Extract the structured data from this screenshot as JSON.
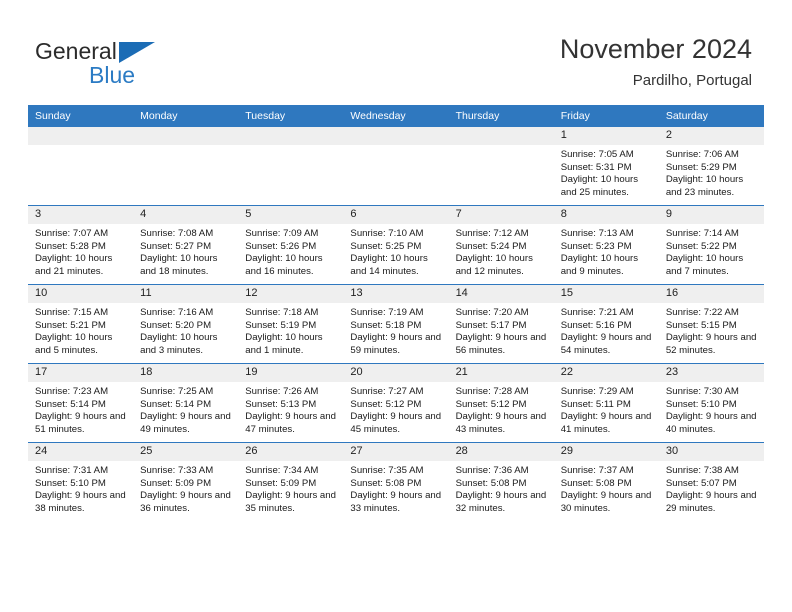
{
  "brand": {
    "name_part1": "General",
    "name_part2": "Blue",
    "triangle_color": "#1b6cb5",
    "blue_color": "#2b7bc4"
  },
  "header": {
    "title": "November 2024",
    "subtitle": "Pardilho, Portugal"
  },
  "theme": {
    "header_row_bg": "#2f78bf",
    "daynum_bg": "#efefef",
    "grid_line": "#2f78bf"
  },
  "weekday_headers": [
    "Sunday",
    "Monday",
    "Tuesday",
    "Wednesday",
    "Thursday",
    "Friday",
    "Saturday"
  ],
  "labels": {
    "sunrise_prefix": "Sunrise:",
    "sunset_prefix": "Sunset:",
    "daylight_prefix": "Daylight:"
  },
  "weeks": [
    [
      {
        "day": "",
        "blank": true,
        "sunrise": "",
        "sunset": "",
        "daylight": ""
      },
      {
        "day": "",
        "blank": true,
        "sunrise": "",
        "sunset": "",
        "daylight": ""
      },
      {
        "day": "",
        "blank": true,
        "sunrise": "",
        "sunset": "",
        "daylight": ""
      },
      {
        "day": "",
        "blank": true,
        "sunrise": "",
        "sunset": "",
        "daylight": ""
      },
      {
        "day": "",
        "blank": true,
        "sunrise": "",
        "sunset": "",
        "daylight": ""
      },
      {
        "day": "1",
        "blank": false,
        "sunrise": "Sunrise: 7:05 AM",
        "sunset": "Sunset: 5:31 PM",
        "daylight": "Daylight: 10 hours and 25 minutes."
      },
      {
        "day": "2",
        "blank": false,
        "sunrise": "Sunrise: 7:06 AM",
        "sunset": "Sunset: 5:29 PM",
        "daylight": "Daylight: 10 hours and 23 minutes."
      }
    ],
    [
      {
        "day": "3",
        "blank": false,
        "sunrise": "Sunrise: 7:07 AM",
        "sunset": "Sunset: 5:28 PM",
        "daylight": "Daylight: 10 hours and 21 minutes."
      },
      {
        "day": "4",
        "blank": false,
        "sunrise": "Sunrise: 7:08 AM",
        "sunset": "Sunset: 5:27 PM",
        "daylight": "Daylight: 10 hours and 18 minutes."
      },
      {
        "day": "5",
        "blank": false,
        "sunrise": "Sunrise: 7:09 AM",
        "sunset": "Sunset: 5:26 PM",
        "daylight": "Daylight: 10 hours and 16 minutes."
      },
      {
        "day": "6",
        "blank": false,
        "sunrise": "Sunrise: 7:10 AM",
        "sunset": "Sunset: 5:25 PM",
        "daylight": "Daylight: 10 hours and 14 minutes."
      },
      {
        "day": "7",
        "blank": false,
        "sunrise": "Sunrise: 7:12 AM",
        "sunset": "Sunset: 5:24 PM",
        "daylight": "Daylight: 10 hours and 12 minutes."
      },
      {
        "day": "8",
        "blank": false,
        "sunrise": "Sunrise: 7:13 AM",
        "sunset": "Sunset: 5:23 PM",
        "daylight": "Daylight: 10 hours and 9 minutes."
      },
      {
        "day": "9",
        "blank": false,
        "sunrise": "Sunrise: 7:14 AM",
        "sunset": "Sunset: 5:22 PM",
        "daylight": "Daylight: 10 hours and 7 minutes."
      }
    ],
    [
      {
        "day": "10",
        "blank": false,
        "sunrise": "Sunrise: 7:15 AM",
        "sunset": "Sunset: 5:21 PM",
        "daylight": "Daylight: 10 hours and 5 minutes."
      },
      {
        "day": "11",
        "blank": false,
        "sunrise": "Sunrise: 7:16 AM",
        "sunset": "Sunset: 5:20 PM",
        "daylight": "Daylight: 10 hours and 3 minutes."
      },
      {
        "day": "12",
        "blank": false,
        "sunrise": "Sunrise: 7:18 AM",
        "sunset": "Sunset: 5:19 PM",
        "daylight": "Daylight: 10 hours and 1 minute."
      },
      {
        "day": "13",
        "blank": false,
        "sunrise": "Sunrise: 7:19 AM",
        "sunset": "Sunset: 5:18 PM",
        "daylight": "Daylight: 9 hours and 59 minutes."
      },
      {
        "day": "14",
        "blank": false,
        "sunrise": "Sunrise: 7:20 AM",
        "sunset": "Sunset: 5:17 PM",
        "daylight": "Daylight: 9 hours and 56 minutes."
      },
      {
        "day": "15",
        "blank": false,
        "sunrise": "Sunrise: 7:21 AM",
        "sunset": "Sunset: 5:16 PM",
        "daylight": "Daylight: 9 hours and 54 minutes."
      },
      {
        "day": "16",
        "blank": false,
        "sunrise": "Sunrise: 7:22 AM",
        "sunset": "Sunset: 5:15 PM",
        "daylight": "Daylight: 9 hours and 52 minutes."
      }
    ],
    [
      {
        "day": "17",
        "blank": false,
        "sunrise": "Sunrise: 7:23 AM",
        "sunset": "Sunset: 5:14 PM",
        "daylight": "Daylight: 9 hours and 51 minutes."
      },
      {
        "day": "18",
        "blank": false,
        "sunrise": "Sunrise: 7:25 AM",
        "sunset": "Sunset: 5:14 PM",
        "daylight": "Daylight: 9 hours and 49 minutes."
      },
      {
        "day": "19",
        "blank": false,
        "sunrise": "Sunrise: 7:26 AM",
        "sunset": "Sunset: 5:13 PM",
        "daylight": "Daylight: 9 hours and 47 minutes."
      },
      {
        "day": "20",
        "blank": false,
        "sunrise": "Sunrise: 7:27 AM",
        "sunset": "Sunset: 5:12 PM",
        "daylight": "Daylight: 9 hours and 45 minutes."
      },
      {
        "day": "21",
        "blank": false,
        "sunrise": "Sunrise: 7:28 AM",
        "sunset": "Sunset: 5:12 PM",
        "daylight": "Daylight: 9 hours and 43 minutes."
      },
      {
        "day": "22",
        "blank": false,
        "sunrise": "Sunrise: 7:29 AM",
        "sunset": "Sunset: 5:11 PM",
        "daylight": "Daylight: 9 hours and 41 minutes."
      },
      {
        "day": "23",
        "blank": false,
        "sunrise": "Sunrise: 7:30 AM",
        "sunset": "Sunset: 5:10 PM",
        "daylight": "Daylight: 9 hours and 40 minutes."
      }
    ],
    [
      {
        "day": "24",
        "blank": false,
        "sunrise": "Sunrise: 7:31 AM",
        "sunset": "Sunset: 5:10 PM",
        "daylight": "Daylight: 9 hours and 38 minutes."
      },
      {
        "day": "25",
        "blank": false,
        "sunrise": "Sunrise: 7:33 AM",
        "sunset": "Sunset: 5:09 PM",
        "daylight": "Daylight: 9 hours and 36 minutes."
      },
      {
        "day": "26",
        "blank": false,
        "sunrise": "Sunrise: 7:34 AM",
        "sunset": "Sunset: 5:09 PM",
        "daylight": "Daylight: 9 hours and 35 minutes."
      },
      {
        "day": "27",
        "blank": false,
        "sunrise": "Sunrise: 7:35 AM",
        "sunset": "Sunset: 5:08 PM",
        "daylight": "Daylight: 9 hours and 33 minutes."
      },
      {
        "day": "28",
        "blank": false,
        "sunrise": "Sunrise: 7:36 AM",
        "sunset": "Sunset: 5:08 PM",
        "daylight": "Daylight: 9 hours and 32 minutes."
      },
      {
        "day": "29",
        "blank": false,
        "sunrise": "Sunrise: 7:37 AM",
        "sunset": "Sunset: 5:08 PM",
        "daylight": "Daylight: 9 hours and 30 minutes."
      },
      {
        "day": "30",
        "blank": false,
        "sunrise": "Sunrise: 7:38 AM",
        "sunset": "Sunset: 5:07 PM",
        "daylight": "Daylight: 9 hours and 29 minutes."
      }
    ]
  ]
}
